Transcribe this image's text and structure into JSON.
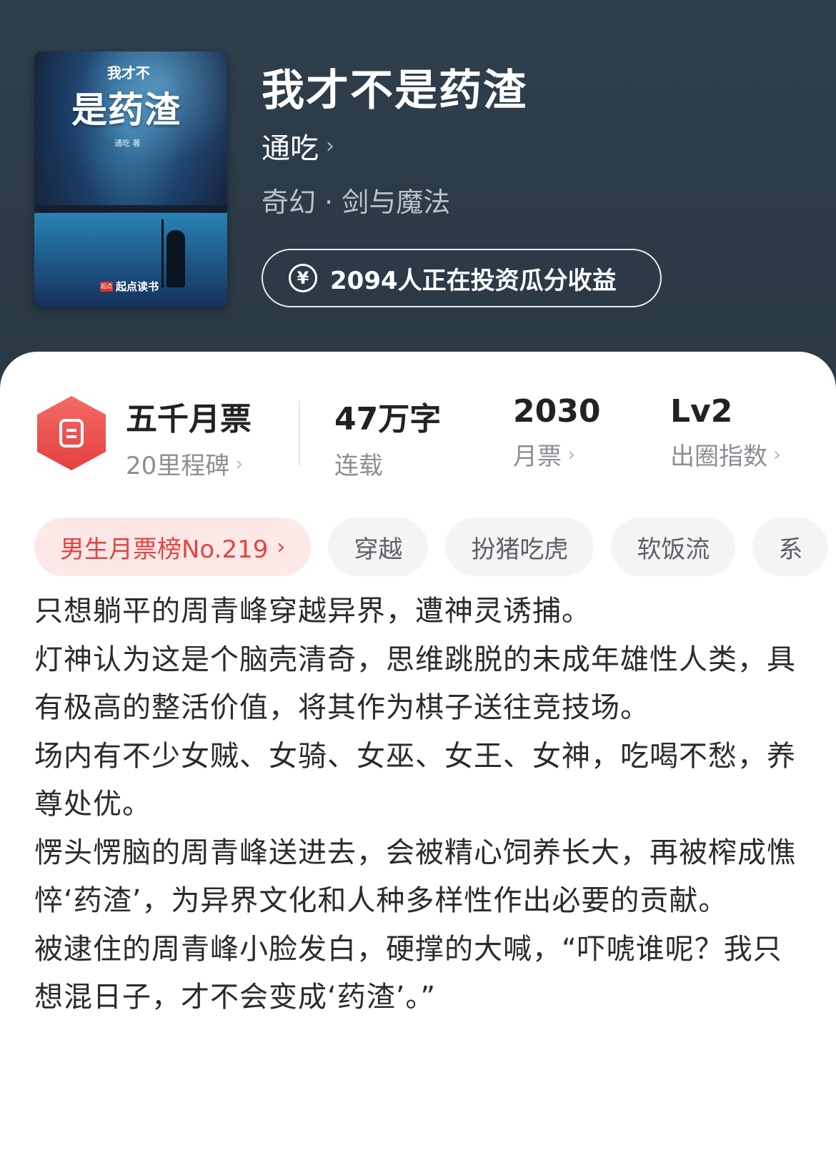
{
  "cover": {
    "small_title": "我才不",
    "big_title": "是药渣",
    "author": "通吃 著",
    "publisher": "起点读书"
  },
  "book": {
    "title": "我才不是药渣",
    "author": "通吃",
    "genre": "奇幻 · 剑与魔法",
    "invest_text": "2094人正在投资瓜分收益"
  },
  "stats": {
    "milestone": {
      "value": "五千月票",
      "sub": "20里程碑"
    },
    "words": {
      "value": "47万字",
      "sub": "连载"
    },
    "monthly": {
      "value": "2030",
      "sub": "月票"
    },
    "circle": {
      "value": "Lv2",
      "sub": "出圈指数"
    }
  },
  "tags": {
    "rank": "男生月票榜No.219",
    "items": [
      "穿越",
      "扮猪吃虎",
      "软饭流",
      "系"
    ]
  },
  "description": [
    "只想躺平的周青峰穿越异界，遭神灵诱捕。",
    "灯神认为这是个脑壳清奇，思维跳脱的未成年雄性人类，具有极高的整活价值，将其作为棋子送往竞技场。",
    "场内有不少女贼、女骑、女巫、女王、女神，吃喝不愁，养尊处优。",
    "愣头愣脑的周青峰送进去，会被精心饲养长大，再被榨成憔悴‘药渣’，为异界文化和人种多样性作出必要的贡献。",
    "被逮住的周青峰小脸发白，硬撑的大喊，“吓唬谁呢？我只想混日子，才不会变成‘药渣’。”"
  ],
  "colors": {
    "header_bg": "#2f3f4d",
    "accent_red": "#e3453f",
    "tag_bg": "#f4f4f5"
  },
  "icons": {
    "chevron": "chevron-right-icon",
    "yen": "yen-coin-icon",
    "ticket": "ticket-icon"
  }
}
